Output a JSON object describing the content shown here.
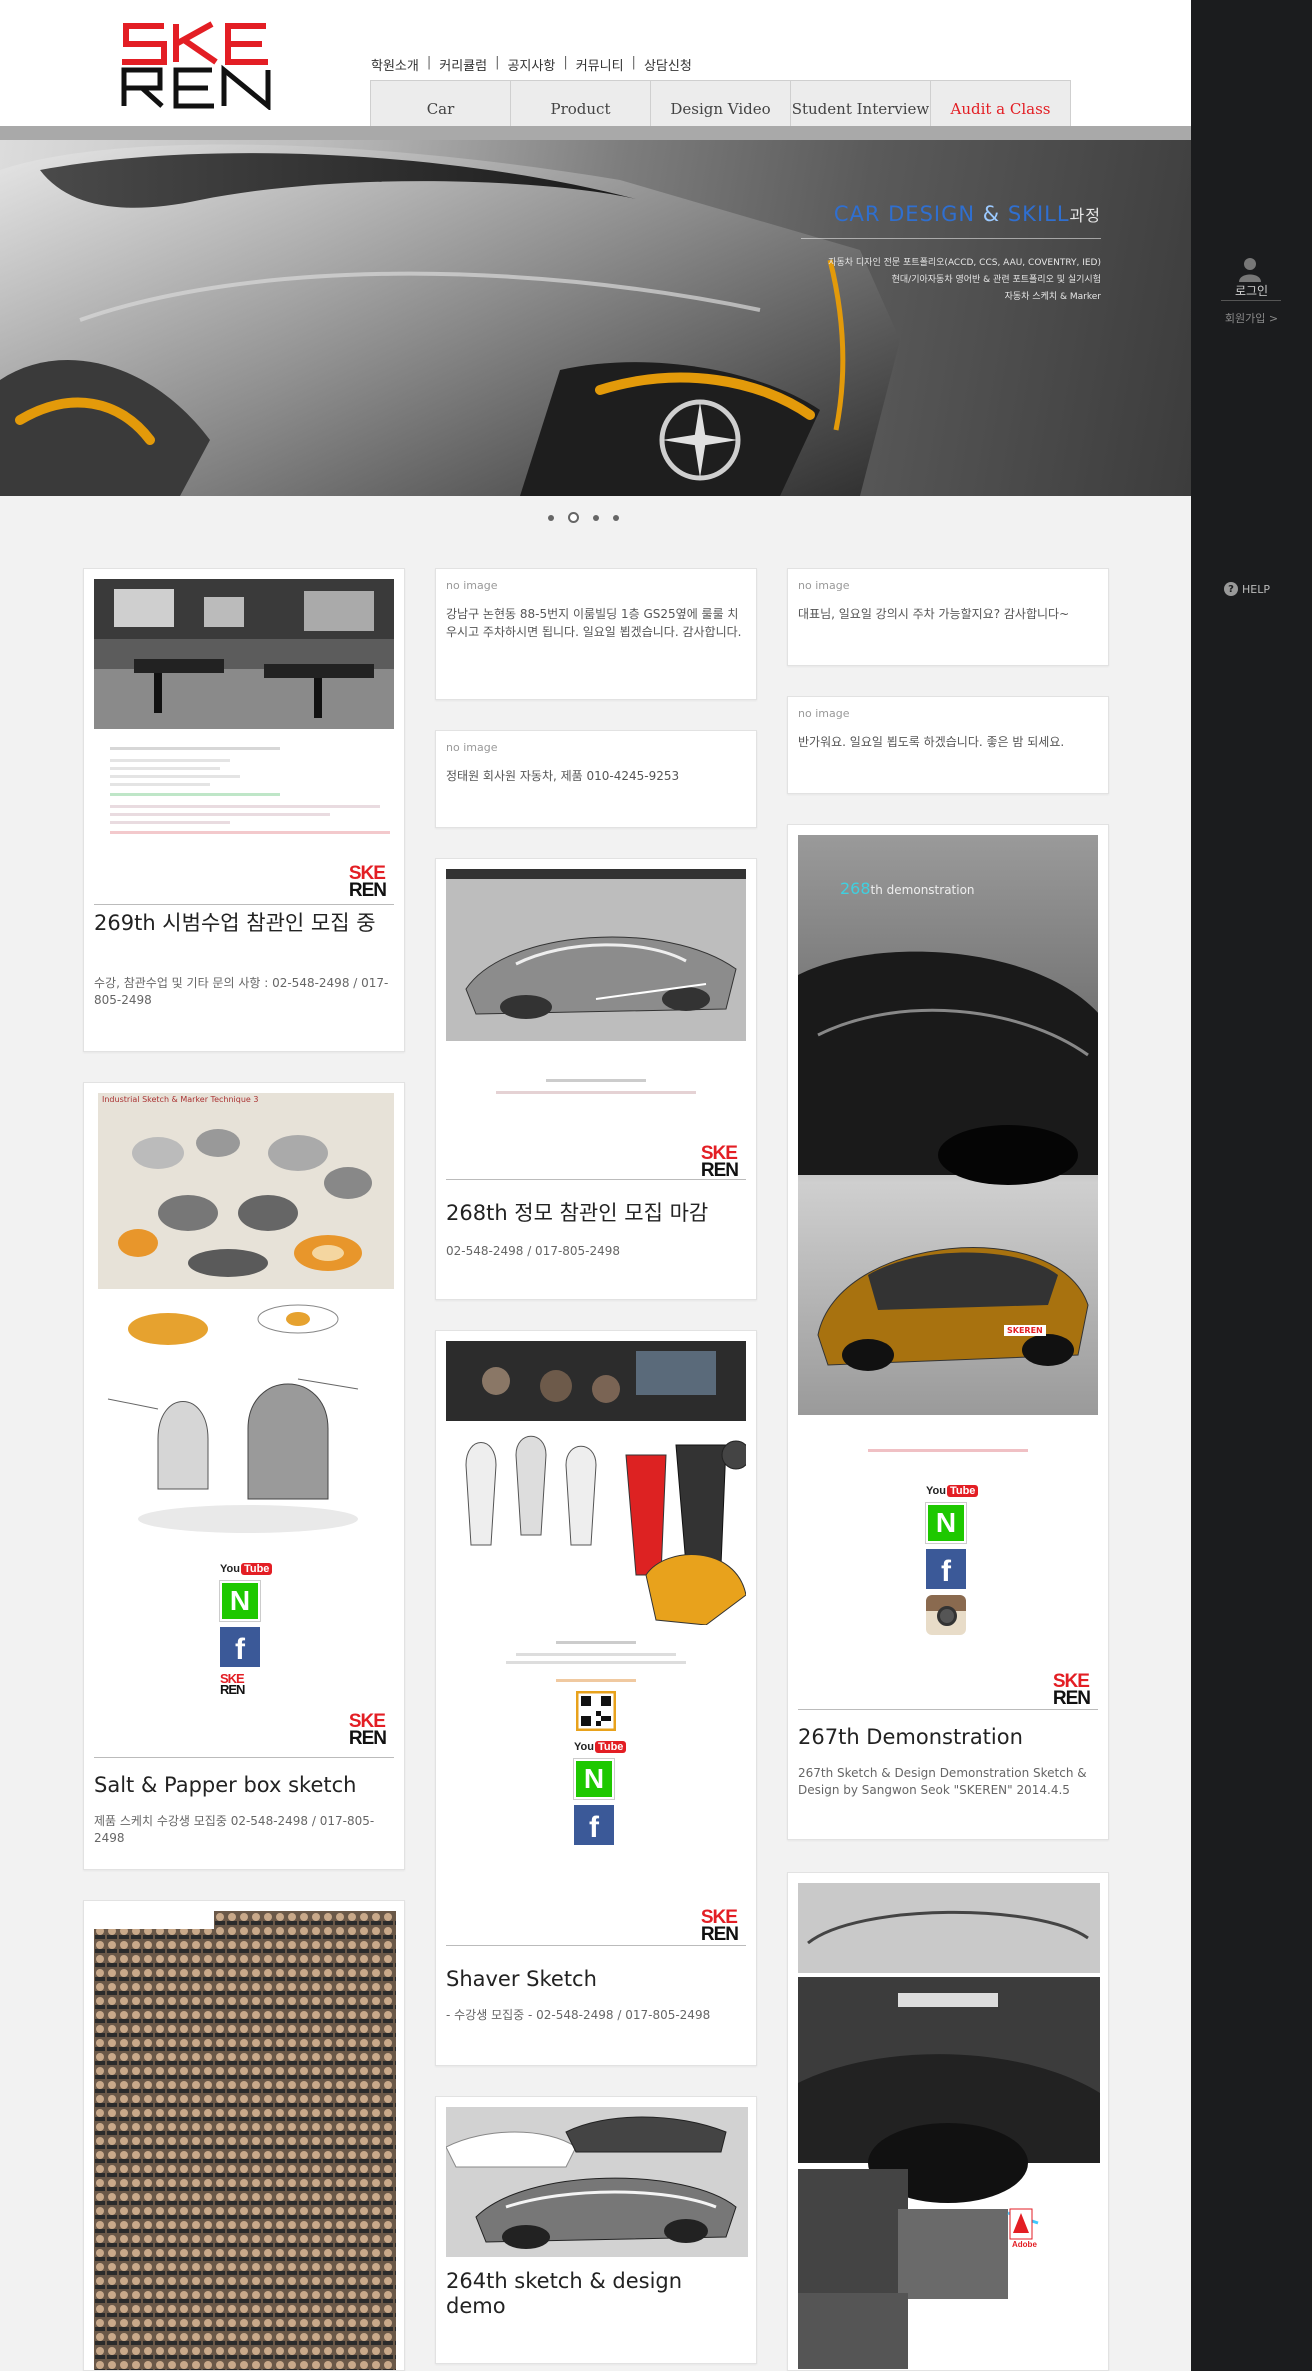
{
  "brand": {
    "logo_line1": "SKE",
    "logo_line2": "REN"
  },
  "top_nav": [
    "학원소개",
    "커리큘럼",
    "공지사항",
    "커뮤니티",
    "상담신청"
  ],
  "top_nav_separator": "|",
  "main_nav": [
    {
      "label": "Car",
      "accent": false
    },
    {
      "label": "Product",
      "accent": false
    },
    {
      "label": "Design Video",
      "accent": false
    },
    {
      "label": "Student Interview",
      "accent": false
    },
    {
      "label": "Audit a Class",
      "accent": true
    }
  ],
  "hero": {
    "title_part1": "CAR DESIGN",
    "title_amp": "&",
    "title_part2": "SKILL",
    "title_suffix": "과정",
    "desc_line1": "자동차 디자인 전문 포트폴리오(ACCD, CCS, AAU, COVENTRY, IED)",
    "desc_line2": "현대/기아자동차 영어반 & 관련 포트폴리오 및 실기시험",
    "desc_line3": "자동차 스케치 & Marker"
  },
  "slider": {
    "dot_count": 4,
    "active_index": 1
  },
  "sidebar": {
    "login": "로그인",
    "join": "회원가입 >",
    "help": "HELP",
    "help_badge": "?"
  },
  "cards": {
    "c1": {
      "title": "269th 시범수업 참관인 모집 중",
      "desc": "수강, 참관수업 및 기타 문의 사항 : 02-548-2498 / 017-805-2498"
    },
    "c2": {
      "title": "Salt & Papper box sketch",
      "desc": "제품 스케치 수강생 모집중 02-548-2498 / 017-805-2498",
      "inner_heading": "Industrial Sketch & Marker Technique 3",
      "youtube_label": "You",
      "youtube_tube": "Tube"
    },
    "c4": {
      "noimg": "no image",
      "text": "강남구 논현동 88-5번지 이룸빌딩 1층 GS25옆에 룰룰 치우시고 주차하시면 됩니다. 일요일 뵙겠습니다. 감사합니다."
    },
    "c5": {
      "noimg": "no image",
      "text": "정태원 회사원 자동차, 제품 010-4245-9253"
    },
    "c6": {
      "title": "268th 정모 참관인 모집 마감",
      "desc": "02-548-2498 / 017-805-2498"
    },
    "c7": {
      "title": "Shaver Sketch",
      "desc": "- 수강생 모집중 - 02-548-2498 / 017-805-2498",
      "youtube_label": "You",
      "youtube_tube": "Tube"
    },
    "c8": {
      "title": "264th sketch & design demo"
    },
    "c9": {
      "noimg": "no image",
      "text": "대표님, 일요일 강의시 주차 가능할지요? 감사합니다~"
    },
    "c10": {
      "noimg": "no image",
      "text": "반가워요. 일요일 뵙도록 하겠습니다. 좋은 밤 되세요."
    },
    "c11": {
      "title": "267th Demonstration",
      "desc": "267th Sketch & Design Demonstration Sketch & Design by Sangwon Seok \"SKEREN\" 2014.4.5",
      "inner_heading_num": "268",
      "inner_heading_rest": "th demonstration",
      "car_badge": "SKEREN",
      "youtube_label": "You",
      "youtube_tube": "Tube"
    },
    "c12": {
      "adobe_label": "Adobe"
    }
  },
  "colors": {
    "accent_red": "#e31e24",
    "sidebar": "#1b1c1e",
    "hero_blue": "#2f6fd0"
  }
}
